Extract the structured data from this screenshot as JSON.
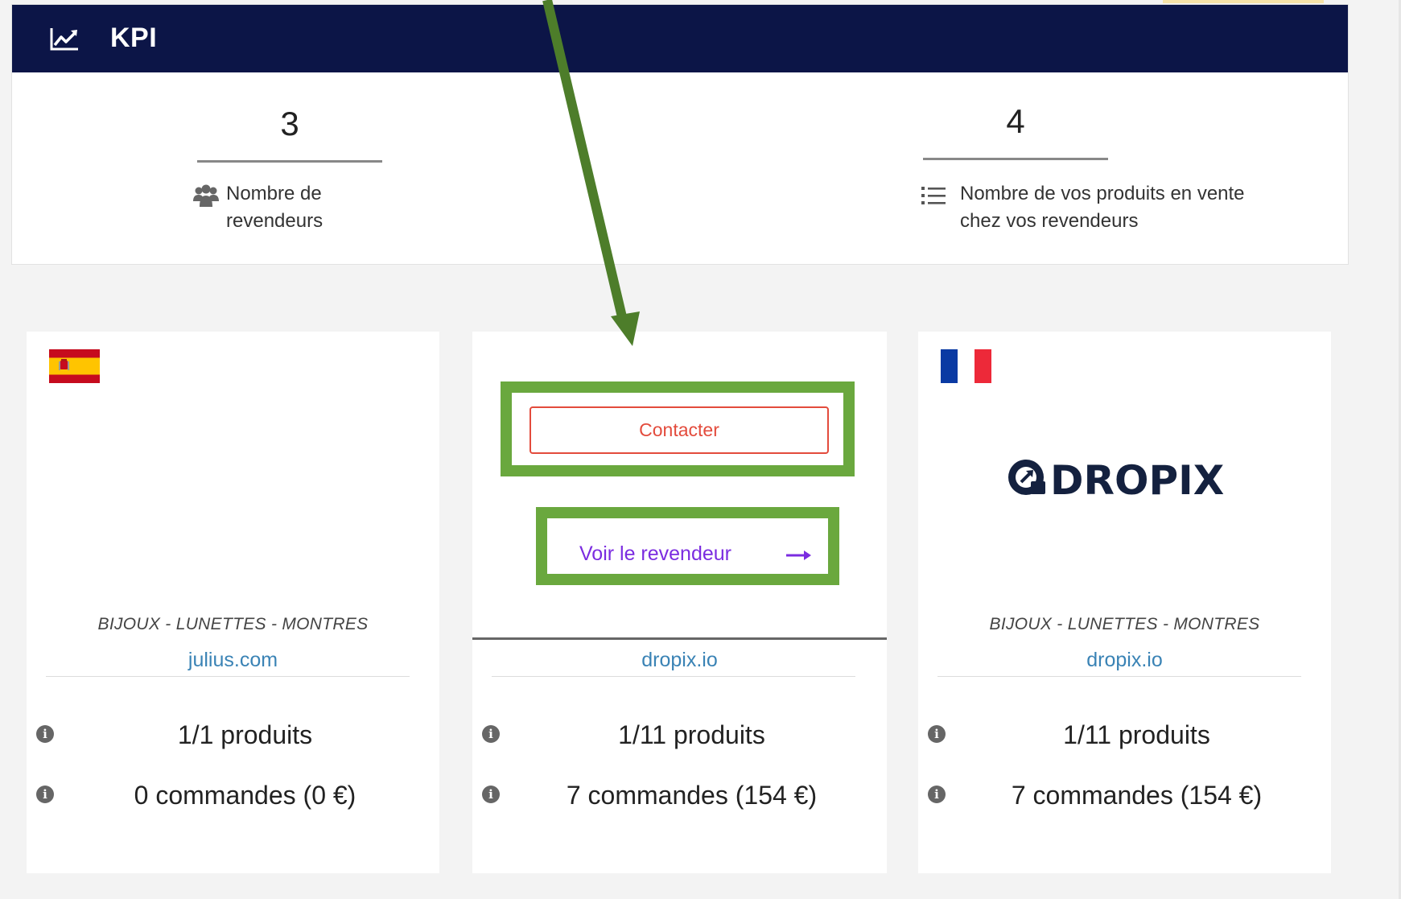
{
  "kpi": {
    "title": "KPI",
    "resellers_count": "3",
    "resellers_label_line1": "Nombre de",
    "resellers_label_line2": "revendeurs",
    "products_count": "4",
    "products_label_line1": "Nombre de vos produits en vente",
    "products_label_line2": "chez vos revendeurs"
  },
  "cards": [
    {
      "flag": "spain-flag",
      "category": "BIJOUX -  LUNETTES - MONTRES",
      "site": "julius.com",
      "products": "1/1 produits",
      "orders": "0 commandes (0 €)"
    },
    {
      "contact_label": "Contacter",
      "view_label": "Voir le revendeur",
      "site": "dropix.io",
      "products": "1/11 produits",
      "orders": "7 commandes (154 €)"
    },
    {
      "flag": "france-flag",
      "logo": "DROPIX",
      "category": "BIJOUX -  LUNETTES - MONTRES",
      "site": "dropix.io",
      "products": "1/11 produits",
      "orders": "7 commandes (154 €)"
    }
  ],
  "colors": {
    "header_bg": "#0c1547",
    "highlight_box": "#6aa83e",
    "arrow": "#4d7d2a",
    "contact": "#e34b3c",
    "link": "#3a83b5",
    "view_link": "#7b2ce0"
  }
}
